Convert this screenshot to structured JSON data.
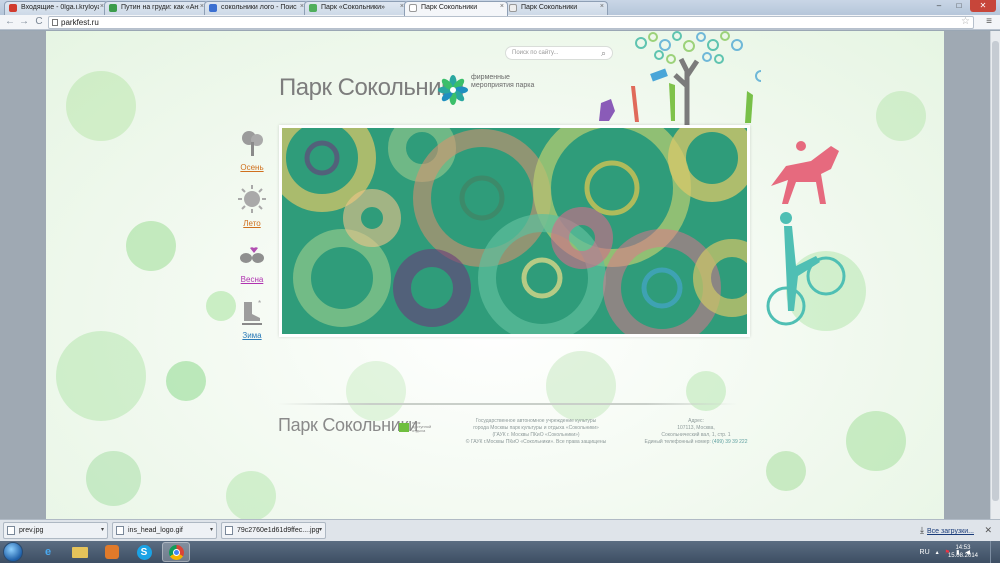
{
  "browser": {
    "tabs": [
      {
        "label": "Входящие - 0lga.i.kryloya",
        "color": "#d13b2e"
      },
      {
        "label": "Путин на груди: как «Ан»",
        "color": "#3b9c4b"
      },
      {
        "label": "сокольники лого - Поис",
        "color": "#3b6fd1"
      },
      {
        "label": "Парк «Сокольники»",
        "color": "#4fae5c"
      },
      {
        "label": "Парк Сокольники",
        "color": "#ffffff"
      },
      {
        "label": "Парк Сокольники",
        "color": "#dddddd"
      }
    ],
    "active_tab": 4,
    "address": "parkfest.ru",
    "window_controls": {
      "minimize": "–",
      "maximize": "□",
      "close": "✕"
    },
    "nav": {
      "back": "←",
      "forward": "→",
      "reload": "C"
    },
    "icons": {
      "star": "star-icon",
      "menu": "menu-icon"
    }
  },
  "site": {
    "search_placeholder": "Поиск по сайту...",
    "logo_title": "Парк Сокольники",
    "logo_subtitle": "фирменные мероприятия парка",
    "seasons": [
      {
        "label": "Осень",
        "color": "#d0701e",
        "icon": "tree-icon"
      },
      {
        "label": "Лето",
        "color": "#d0701e",
        "icon": "sun-icon"
      },
      {
        "label": "Весна",
        "color": "#b033b0",
        "icon": "birds-icon"
      },
      {
        "label": "Зима",
        "color": "#2a7bb8",
        "icon": "skate-icon"
      }
    ],
    "footer": {
      "logo": "Парк Сокольники",
      "mark_text": "парк доступной отдыха",
      "org_line1": "Государственное автономное учреждение культуры",
      "org_line2": "города Москвы парк культуры и отдыха «Сокольники»",
      "org_line3": "(ГАУК г. Москвы ПКиО «Сокольники»)",
      "copyright": "© ГАУК г.Москвы ПКиО «Сокольники». Все права защищены",
      "address_label": "Адрес:",
      "address_zip": "107113, Москва,",
      "address_street": "Сокольнический вал, 1, стр. 1",
      "phone_label": "Единый телефонный номер:",
      "phone": "(499) 39 39 222"
    }
  },
  "downloads": {
    "items": [
      "prev.jpg",
      "ins_head_logo.gif",
      "79c2760e1d61d9ffec....jpg"
    ],
    "show_all": "Все загрузки...",
    "close": "✕"
  },
  "taskbar": {
    "apps": [
      "start",
      "ie",
      "explorer",
      "media",
      "skype",
      "chrome"
    ],
    "lang": "RU",
    "time": "14:53",
    "date": "15.08.2014"
  }
}
